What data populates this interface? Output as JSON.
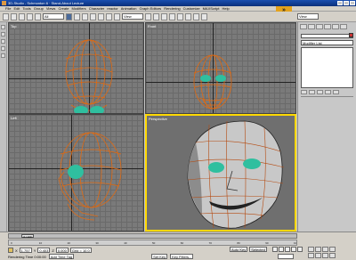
{
  "window": {
    "title": "3D-Studio - Schmonton 6 · Stand-About Lecture"
  },
  "menu": [
    "File",
    "Edit",
    "Tools",
    "Group",
    "Views",
    "Create",
    "Modifiers",
    "Character",
    "reactor",
    "Animation",
    "Graph Editors",
    "Rendering",
    "Customize",
    "MAXScript",
    "Help"
  ],
  "toolbar": {
    "selection_filter": "All",
    "view_space": "View",
    "coord_space": "View"
  },
  "viewports": {
    "top": "Top",
    "front": "Front",
    "left": "Left",
    "perspective": "Perspective"
  },
  "command_panel": {
    "modifier_list": "Modifier List"
  },
  "timeline": {
    "frame_label": "0 / 100",
    "ticks": [
      "0",
      "10",
      "20",
      "30",
      "40",
      "50",
      "60",
      "70",
      "80",
      "90",
      "100"
    ]
  },
  "status": {
    "x_value": "1.757",
    "y_value": "0.403",
    "z_value": "0.000",
    "grid_label": "Grid = 10.0",
    "auto_key": "Auto Key",
    "selected": "Selected",
    "set_key": "Set Key",
    "key_filters": "Key Filters...",
    "rendering_time": "Rendering Time  0:00:00",
    "add_time_tag": "Add Time Tag"
  },
  "colors": {
    "wire": "#e06a12",
    "eye": "#2fbf9f",
    "active_border": "#ffd800",
    "title_bar": "#0b2f7a"
  }
}
